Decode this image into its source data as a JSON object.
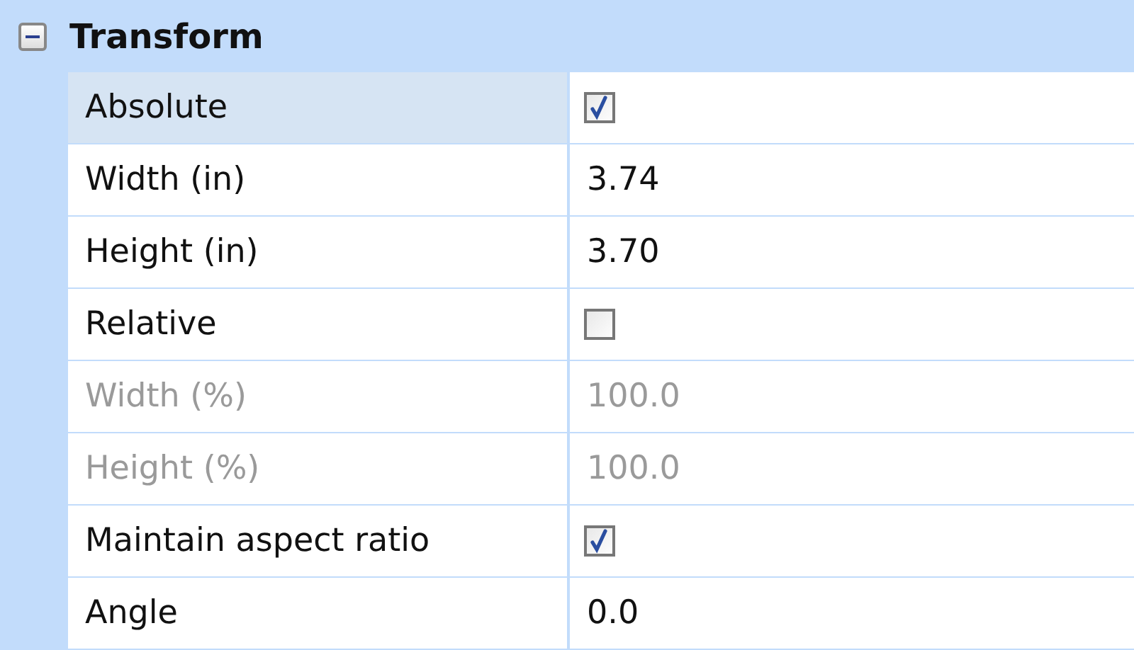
{
  "category": {
    "title": "Transform",
    "expanded": true
  },
  "properties": [
    {
      "name": "Absolute",
      "kind": "checkbox",
      "checked": true,
      "disabled": false,
      "selected": true
    },
    {
      "name": "Width (in)",
      "kind": "text",
      "value": "3.74",
      "disabled": false,
      "selected": false
    },
    {
      "name": "Height (in)",
      "kind": "text",
      "value": "3.70",
      "disabled": false,
      "selected": false
    },
    {
      "name": "Relative",
      "kind": "checkbox",
      "checked": false,
      "disabled": false,
      "selected": false
    },
    {
      "name": "Width (%)",
      "kind": "text",
      "value": "100.0",
      "disabled": true,
      "selected": false
    },
    {
      "name": "Height (%)",
      "kind": "text",
      "value": "100.0",
      "disabled": true,
      "selected": false
    },
    {
      "name": "Maintain aspect ratio",
      "kind": "checkbox",
      "checked": true,
      "disabled": false,
      "selected": false
    },
    {
      "name": "Angle",
      "kind": "text",
      "value": "0.0",
      "disabled": false,
      "selected": false
    }
  ]
}
